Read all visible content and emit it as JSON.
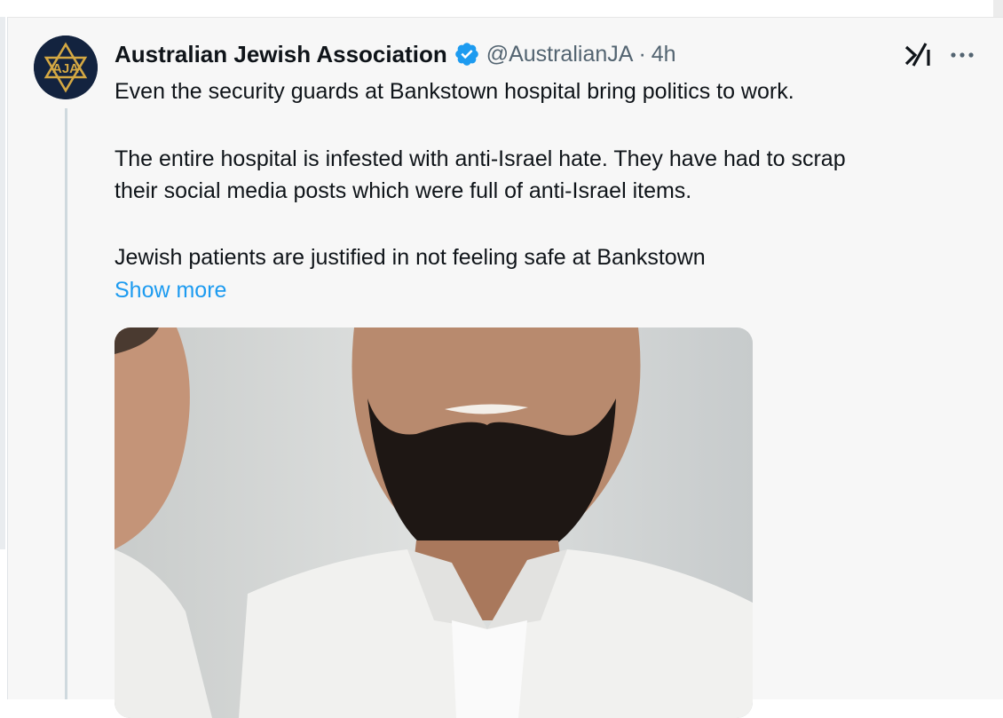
{
  "post": {
    "author_name": "Australian Jewish Association",
    "handle": "@AustralianJA",
    "separator": "·",
    "time": "4h",
    "avatar_text": "AJA",
    "lines": [
      "Even the security guards at Bankstown hospital bring politics to work.",
      "The entire hospital is infested with anti-Israel hate. They have had to scrap",
      "their social media posts which were full of anti-Israel items.",
      "Jewish patients are justified in not feeling safe at Bankstown"
    ],
    "show_more": "Show more"
  },
  "icons": {
    "verified": "verified-badge-icon",
    "grok": "grok-icon",
    "more": "more-options-icon"
  },
  "colors": {
    "verified": "#1d9bf0",
    "link": "#1d9bf0",
    "avatar_bg": "#13233f",
    "avatar_gold": "#d4a843"
  }
}
